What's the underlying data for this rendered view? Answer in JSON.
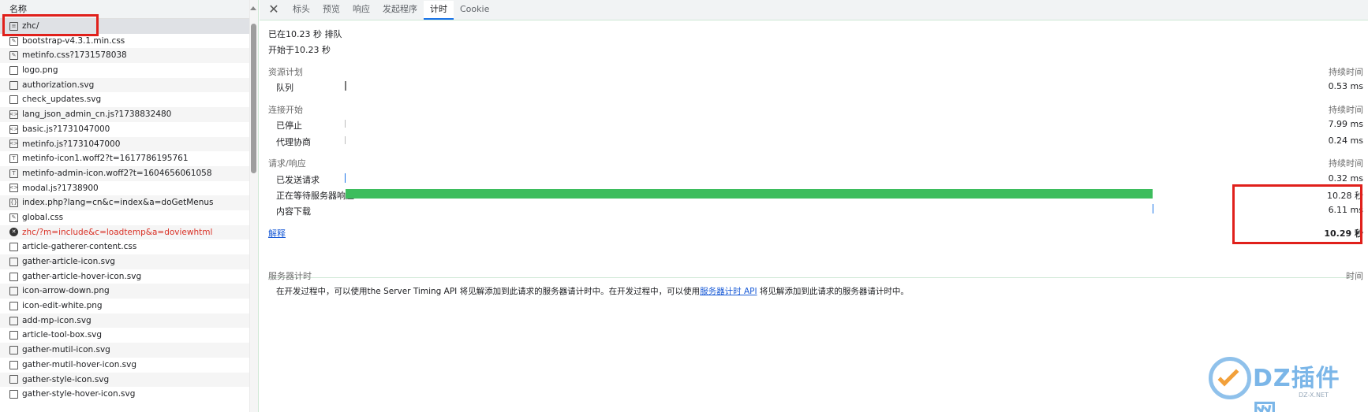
{
  "request_list": {
    "header": "名称",
    "items": [
      {
        "name": "zhc/",
        "icon": "document-icon",
        "glyph": "≡"
      },
      {
        "name": "bootstrap-v4.3.1.min.css",
        "icon": "stylesheet-icon",
        "glyph": "✎"
      },
      {
        "name": "metinfo.css?1731578038",
        "icon": "stylesheet-icon",
        "glyph": "✎"
      },
      {
        "name": "logo.png",
        "icon": "image-file-icon",
        "glyph": ""
      },
      {
        "name": "authorization.svg",
        "icon": "image-file-icon",
        "glyph": ""
      },
      {
        "name": "check_updates.svg",
        "icon": "image-file-icon",
        "glyph": ""
      },
      {
        "name": "lang_json_admin_cn.js?1738832480",
        "icon": "script-icon",
        "glyph": "<>"
      },
      {
        "name": "basic.js?1731047000",
        "icon": "script-icon",
        "glyph": "<>"
      },
      {
        "name": "metinfo.js?1731047000",
        "icon": "script-icon",
        "glyph": "<>"
      },
      {
        "name": "metinfo-icon1.woff2?t=1617786195761",
        "icon": "font-file-icon",
        "glyph": "T"
      },
      {
        "name": "metinfo-admin-icon.woff2?t=1604656061058",
        "icon": "font-file-icon",
        "glyph": "T"
      },
      {
        "name": "modal.js?1738900",
        "icon": "script-icon",
        "glyph": "<>"
      },
      {
        "name": "index.php?lang=cn&c=index&a=doGetMenus",
        "icon": "fetch-icon",
        "glyph": "{}"
      },
      {
        "name": "global.css",
        "icon": "stylesheet-icon",
        "glyph": "✎"
      },
      {
        "name": "zhc/?m=include&c=loadtemp&a=doviewhtml",
        "icon": "error-icon",
        "glyph": "✕",
        "error": true
      },
      {
        "name": "article-gatherer-content.css",
        "icon": "document-icon",
        "glyph": ""
      },
      {
        "name": "gather-article-icon.svg",
        "icon": "image-file-icon",
        "glyph": ""
      },
      {
        "name": "gather-article-hover-icon.svg",
        "icon": "image-file-icon",
        "glyph": ""
      },
      {
        "name": "icon-arrow-down.png",
        "icon": "image-file-icon",
        "glyph": ""
      },
      {
        "name": "icon-edit-white.png",
        "icon": "image-file-icon",
        "glyph": ""
      },
      {
        "name": "add-mp-icon.svg",
        "icon": "image-file-icon",
        "glyph": ""
      },
      {
        "name": "article-tool-box.svg",
        "icon": "image-file-icon",
        "glyph": ""
      },
      {
        "name": "gather-mutil-icon.svg",
        "icon": "image-file-icon",
        "glyph": ""
      },
      {
        "name": "gather-mutil-hover-icon.svg",
        "icon": "image-file-icon",
        "glyph": ""
      },
      {
        "name": "gather-style-icon.svg",
        "icon": "image-file-icon",
        "glyph": ""
      },
      {
        "name": "gather-style-hover-icon.svg",
        "icon": "image-file-icon",
        "glyph": ""
      }
    ]
  },
  "tabs": {
    "close": "✕",
    "items": [
      "标头",
      "预览",
      "响应",
      "发起程序",
      "计时",
      "Cookie"
    ],
    "active_index": 4
  },
  "timing": {
    "queued_at": "已在10.23 秒 排队",
    "started_at": "开始于10.23 秒",
    "sections": {
      "resource_scheduling": {
        "title": "资源计划",
        "duration_label": "持续时间"
      },
      "connection_start": {
        "title": "连接开始",
        "duration_label": "持续时间"
      },
      "request_response": {
        "title": "请求/响应",
        "duration_label": "持续时间"
      }
    },
    "rows": {
      "queue": {
        "label": "队列",
        "value": "0.53 ms",
        "bar_color": "#777777"
      },
      "stalled": {
        "label": "已停止",
        "value": "7.99 ms",
        "bar_color": "#bbbbbb"
      },
      "proxy": {
        "label": "代理协商",
        "value": "0.24 ms",
        "bar_color": "#bbbbbb"
      },
      "request_sent": {
        "label": "已发送请求",
        "value": "0.32 ms",
        "bar_color": "#1a73e8"
      },
      "waiting": {
        "label": "正在等待服务器响应",
        "value": "10.28 秒",
        "bar_color": "#3dbd5d"
      },
      "download": {
        "label": "内容下载",
        "value": "6.11 ms",
        "bar_color": "#1a73e8"
      }
    },
    "explanation_link": "解释",
    "total": "10.29 秒"
  },
  "server_timing": {
    "title": "服务器计时",
    "time_label": "时间",
    "desc_before": "在开发过程中，可以使用the Server Timing API 将见解添加到此请求的服务器请计时中。在开发过程中，可以使用",
    "desc_link": "服务器计时 API",
    "desc_after": " 将见解添加到此请求的服务器请计时中。"
  },
  "watermark": {
    "text": "DZ插件网",
    "sub": "DZ-X.NET"
  },
  "colors": {
    "highlight_red": "#e0201b",
    "accent_green": "#3dbd5d",
    "link_blue": "#1a5bd6"
  }
}
